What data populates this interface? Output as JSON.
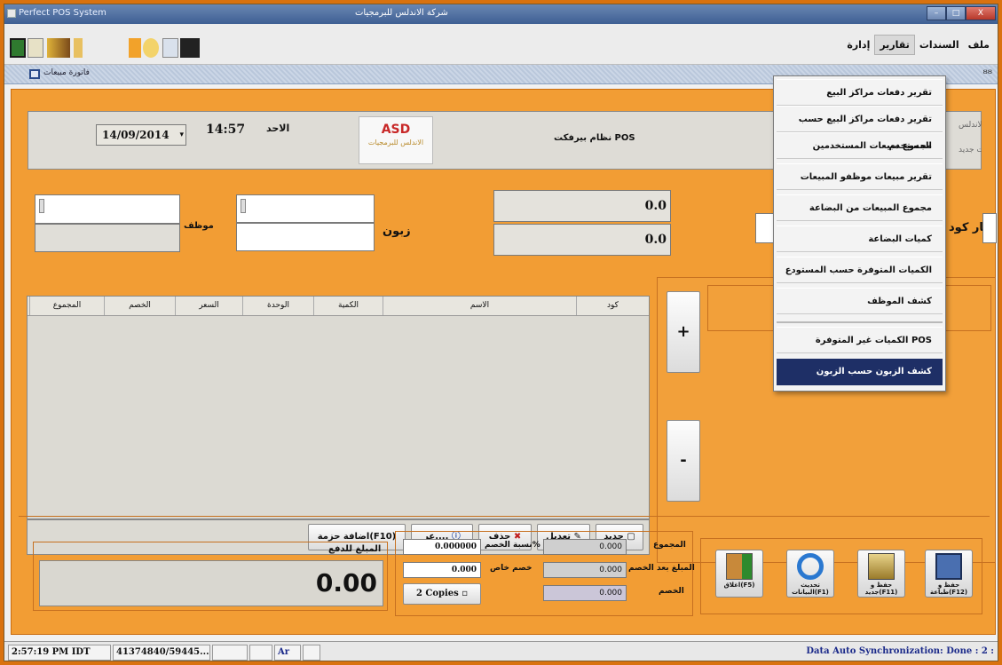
{
  "window": {
    "app_title": "Perfect POS System",
    "center_title": "شركة الاندلس للبرمجيات",
    "controls": {
      "min": "–",
      "max": "□",
      "close": "X"
    }
  },
  "menu": {
    "file": "ملف",
    "documents": "السندات",
    "reports": "تقارير",
    "admin": "إدارة"
  },
  "tab": {
    "label": "فاتورة مبيعات",
    "right_icons": "ᴽᴽ"
  },
  "header": {
    "date": "14/09/2014",
    "time": "14:57",
    "day": "الاحد",
    "system_name": "نظام بيرفكت POS",
    "company_cut": "شركة الاندلس",
    "sales_cut": "مبيعات جديد",
    "logo_text": "ASD",
    "logo_sub": "الاندلس للبرمجيات"
  },
  "form": {
    "employee_label": "موظف",
    "customer_label": "زبون",
    "barcode_label": "بار كود",
    "total1": "0.0",
    "total2": "0.0"
  },
  "table": {
    "columns": [
      "كود",
      "الاسم",
      "الكمية",
      "الوحدة",
      "السعر",
      "الخصم",
      "المجموع"
    ]
  },
  "buttons": {
    "new": "جديد",
    "edit": "تعديل",
    "delete": "حذف",
    "view": "عر....",
    "add_package": "اضافة حزمة(F10)",
    "plus": "+",
    "minus": "-"
  },
  "totals": {
    "total_label": "المجموع",
    "total_value": "0.000",
    "after_discount_label": "المبلغ بعد الخصم",
    "after_discount_value": "0.000",
    "discount_label": "الخصم",
    "discount_value": "0.000",
    "discount_pct_label": "نسبة الخصم%",
    "discount_pct_value": "0.000000",
    "special_discount_label": "خصم خاص",
    "special_discount_value": "0.000",
    "copies": "2 Copies",
    "payable_label": "المبلغ للدفع",
    "payable_value": "0.00"
  },
  "actions": {
    "save_print": "حفظ و طباعة(F12)",
    "save_new": "حفظ و جديد(F11)",
    "refresh": "تحديث البيانات(F1)",
    "close": "اغلاق(F5)"
  },
  "dropdown": {
    "items": [
      "تقرير دفعات مراكز البيع",
      "تقرير دفعات مراكز البيع حسب المستخدم",
      "مجموع مبيعات المستخدمين",
      "تقرير مبيعات موظفو المبيعات",
      "مجموع المبيعات من البضاعة",
      "كميات البضاعة",
      "الكميات المتوفرة حسب المستودع",
      "كشف الموظف",
      "الكميات غير المتوفرة POS",
      "كشف الزبون حسب الزبون"
    ]
  },
  "status": {
    "time": "2:57:19 PM IDT",
    "id": "41374840/59445...",
    "lang": "Ar",
    "sync": "Data Auto Synchronization: Done : 2 :"
  }
}
